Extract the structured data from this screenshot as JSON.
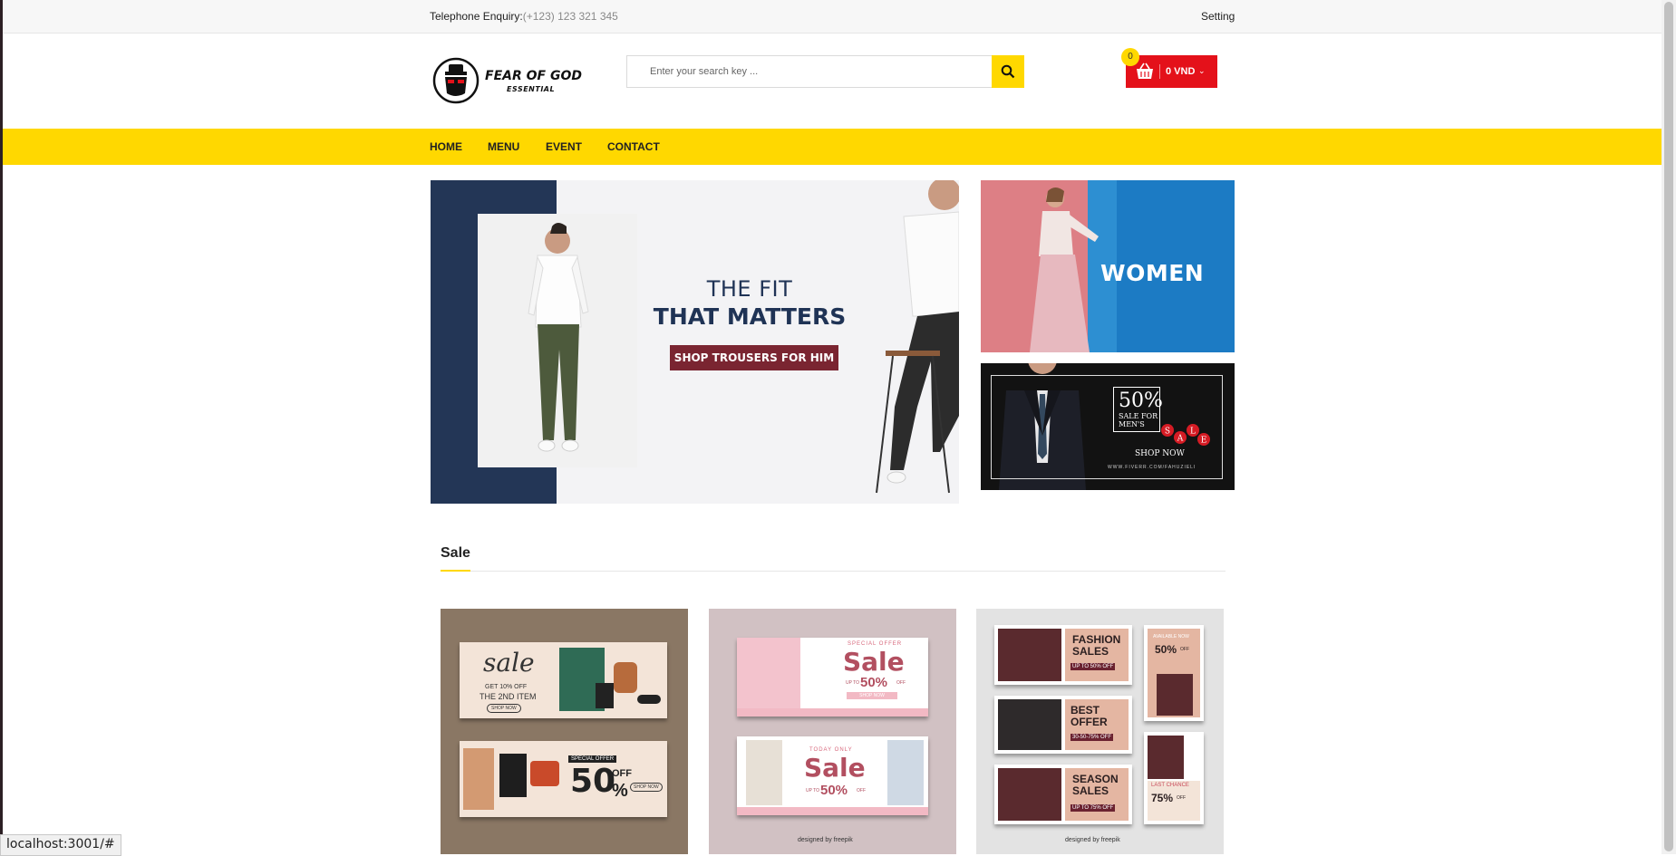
{
  "topbar": {
    "phone_label": "Telephone Enquiry:",
    "phone_number": "(+123) 123 321 345",
    "setting": "Setting"
  },
  "header": {
    "logo_line1": "FEAR OF GOD",
    "logo_line2": "ESSENTIAL",
    "search_placeholder": "Enter your search key ...",
    "cart_count": "0",
    "cart_total": "0 VND"
  },
  "nav": {
    "items": [
      "HOME",
      "MENU",
      "EVENT",
      "CONTACT"
    ]
  },
  "hero": {
    "line1": "THE FIT",
    "line2": "THAT MATTERS",
    "cta": "SHOP TROUSERS FOR HIM"
  },
  "women_banner": {
    "label": "WOMEN"
  },
  "men_banner": {
    "percent": "50%",
    "text": "SALE FOR MEN'S",
    "sale_letters": [
      "S",
      "A",
      "L",
      "E"
    ],
    "cta": "SHOP NOW",
    "url": "WWW.FIVERR.COM/FAHUZIELI"
  },
  "section": {
    "title": "Sale"
  },
  "cards": [
    {
      "top": {
        "title": "sale",
        "sub1": "GET 10% OFF",
        "sub2": "THE 2ND ITEM",
        "btn": "SHOP NOW"
      },
      "bottom": {
        "tag": "SPECIAL OFFER",
        "value": "50",
        "off": "OFF",
        "percent": "%",
        "btn": "SHOP NOW"
      }
    },
    {
      "top": {
        "tag": "SPECIAL OFFER",
        "title": "Sale",
        "upto": "UP TO",
        "value": "50%",
        "off": "OFF",
        "btn": "SHOP NOW"
      },
      "bottom": {
        "tag": "TODAY ONLY",
        "title": "Sale",
        "upto": "UP TO",
        "value": "50%",
        "off": "OFF"
      },
      "credit": "designed by freepik"
    },
    {
      "panels": [
        {
          "line1": "FASHION",
          "line2": "SALES",
          "sub": "UP TO 50% OFF"
        },
        {
          "line1": "AVAILABLE NOW",
          "line2": "50%",
          "sub": "OFF"
        },
        {
          "line1": "BEST",
          "line2": "OFFER",
          "sub": "30-50-75% OFF"
        },
        {
          "line1": "SEASON",
          "line2": "SALES",
          "sub": "UP TO 75% OFF"
        },
        {
          "line1": "LAST CHANCE",
          "line2": "75%",
          "sub": "OFF"
        }
      ],
      "credit": "designed by freepik"
    }
  ],
  "status_url": "localhost:3001/#",
  "colors": {
    "yellow": "#ffd800",
    "red": "#e4111a",
    "navy": "#233656",
    "maroon": "#7a2531"
  }
}
